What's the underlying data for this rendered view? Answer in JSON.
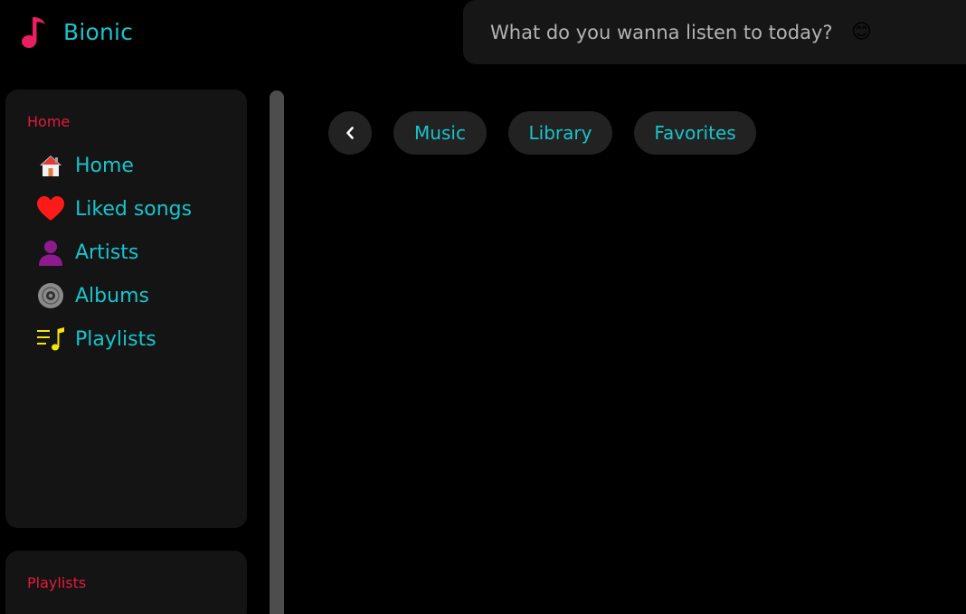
{
  "app": {
    "name": "Bionic",
    "accent": "#18c4cc",
    "brand_icon": "music-note-icon",
    "brand_icon_color": "#e91e63"
  },
  "search": {
    "placeholder": "What do you wanna listen to today?",
    "emoji": "😊"
  },
  "sidebar": {
    "section_label": "Home",
    "section_color": "#e6193c",
    "items": [
      {
        "label": "Home",
        "icon": "house-icon"
      },
      {
        "label": "Liked songs",
        "icon": "heart-icon"
      },
      {
        "label": "Artists",
        "icon": "person-icon"
      },
      {
        "label": "Albums",
        "icon": "disc-icon"
      },
      {
        "label": "Playlists",
        "icon": "playlist-icon"
      }
    ]
  },
  "playlists_section": {
    "label": "Playlists"
  },
  "tabs": {
    "back_icon": "chevron-left-icon",
    "items": [
      {
        "label": "Music"
      },
      {
        "label": "Library"
      },
      {
        "label": "Favorites"
      }
    ]
  }
}
